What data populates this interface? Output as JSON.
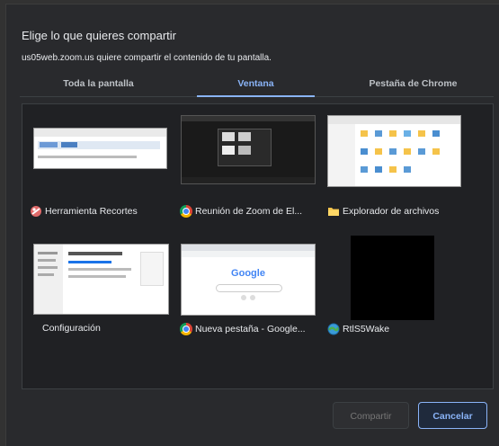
{
  "dialog": {
    "title": "Elige lo que quieres compartir",
    "subtitle": "us05web.zoom.us quiere compartir el contenido de tu pantalla."
  },
  "tabs": [
    {
      "label": "Toda la pantalla",
      "active": false
    },
    {
      "label": "Ventana",
      "active": true
    },
    {
      "label": "Pestaña de Chrome",
      "active": false
    }
  ],
  "windows": [
    {
      "label": "Herramienta Recortes",
      "icon": "snipping-tool-icon"
    },
    {
      "label": "Reunión de Zoom de El...",
      "icon": "chrome-icon"
    },
    {
      "label": "Explorador de archivos",
      "icon": "folder-icon"
    },
    {
      "label": "Configuración",
      "icon": ""
    },
    {
      "label": "Nueva pestaña - Google...",
      "icon": "chrome-icon"
    },
    {
      "label": "RtlS5Wake",
      "icon": "globe-icon"
    }
  ],
  "thumbs": {
    "new_tab_logo": "Google"
  },
  "buttons": {
    "share": "Compartir",
    "cancel": "Cancelar"
  },
  "colors": {
    "accent": "#8ab4f8",
    "background": "#292a2d",
    "panel": "#202124"
  }
}
